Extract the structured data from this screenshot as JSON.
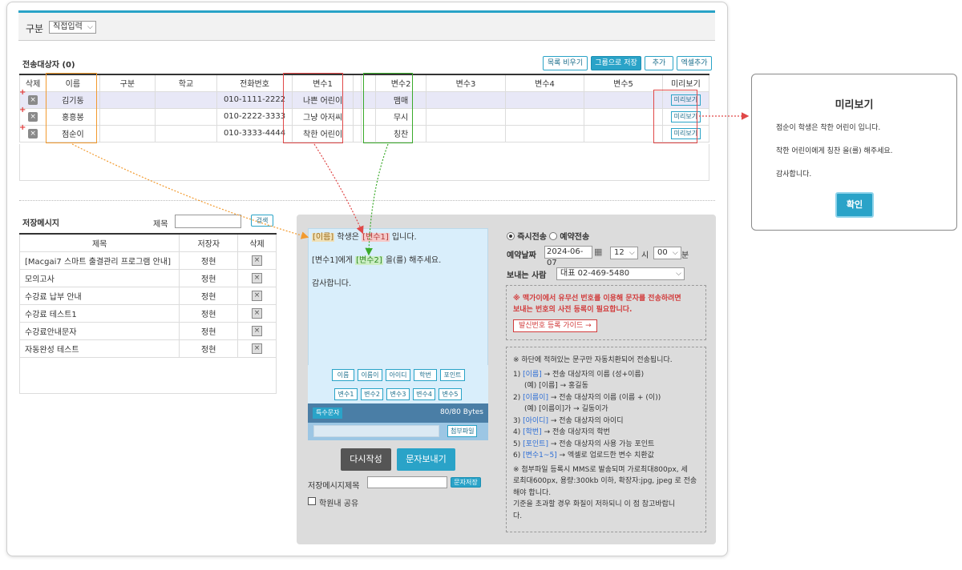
{
  "top": {
    "label": "구분",
    "select_value": "직접입력"
  },
  "recipients": {
    "title": "전송대상자 (0)",
    "buttons": [
      "목록 비우기",
      "그룹으로 저장",
      "추가",
      "엑셀추가"
    ],
    "columns": [
      "삭제",
      "이름",
      "구분",
      "학교",
      "전화번호",
      "변수1",
      "변수2",
      "변수3",
      "변수4",
      "변수5",
      "미리보기"
    ],
    "rows": [
      {
        "name": "김기동",
        "phone": "010-1111-2222",
        "v1": "나쁜 어린이",
        "v2": "맴매",
        "preview": "미리보기"
      },
      {
        "name": "홍흥봉",
        "phone": "010-2222-3333",
        "v1": "그냥 아저씨",
        "v2": "무시",
        "preview": "미리보기"
      },
      {
        "name": "점순이",
        "phone": "010-3333-4444",
        "v1": "착한 어린이",
        "v2": "칭찬",
        "preview": "미리보기"
      }
    ],
    "plus": "+",
    "delete_icon": "×"
  },
  "saved": {
    "title": "저장메시지",
    "search_label": "제목",
    "search_button": "검색",
    "columns": [
      "제목",
      "저장자",
      "삭제"
    ],
    "rows": [
      {
        "title": "[Macgai7 스마트 출결관리 프로그램 안내]",
        "author": "정현"
      },
      {
        "title": "모의고사",
        "author": "정현"
      },
      {
        "title": "수강료 납부 안내",
        "author": "정현"
      },
      {
        "title": "수강료 테스트1",
        "author": "정현"
      },
      {
        "title": "수강료안내문자",
        "author": "정현"
      },
      {
        "title": "자동완성 테스트",
        "author": "정현"
      }
    ]
  },
  "message": {
    "l1_name": "[이름]",
    "l1_mid": " 학생은 ",
    "l1_v1": "[변수1]",
    "l1_end": " 입니다.",
    "l2_start": "[변수1]에게 ",
    "l2_v2": "[변수2]",
    "l2_end": " 을(를) 해주세요.",
    "l3": "감사합니다.",
    "tokens_row1": [
      "이름",
      "이름이",
      "아이디",
      "학번",
      "포인트"
    ],
    "tokens_row2": [
      "변수1",
      "변수2",
      "변수3",
      "변수4",
      "변수5"
    ],
    "special_btn": "특수문자",
    "byte_count": "80/80 Bytes",
    "attach_btn": "첨부파일",
    "rewrite_btn": "다시작성",
    "send_btn": "문자보내기",
    "save_title_label": "저장메시지제목",
    "save_btn": "문자저장",
    "share_label": "학원내 공유"
  },
  "options": {
    "immediate": "즉시전송",
    "reserve": "예약전송",
    "date_label": "예약날짜",
    "date_value": "2024-06-07",
    "hour_value": "12",
    "hour_unit": "시",
    "minute_value": "00",
    "minute_unit": "분",
    "sender_label": "보내는 사람",
    "sender_value": "대표 02-469-5480",
    "warn_line1": "※ 맥가이에서 유무선 번호를 이용해 문자를 전송하려면",
    "warn_line2": "보내는 번호의 사전 등록이 필요합니다.",
    "warn_btn": "발신번호 등록 가이드 →",
    "guide_head": "※ 하단에 적혀있는 문구만 자동치환되어 전송됩니다.",
    "g1_pre": "1) ",
    "g1_k": "[이름]",
    "g1_t": " → 전송 대상자의 이름 (성+이름)",
    "g1_ex": "(예) [이름] → 홍길동",
    "g2_pre": "2) ",
    "g2_k": "[이름이]",
    "g2_t": " → 전송 대상자의 이름 (이름 + (이))",
    "g2_ex": "(예) [이름이]가 → 길동이가",
    "g3_pre": "3) ",
    "g3_k": "[아이디]",
    "g3_t": " → 전송 대상자의 아이디",
    "g4_pre": "4) ",
    "g4_k": "[학번]",
    "g4_t": " → 전송 대상자의 학번",
    "g5_pre": "5) ",
    "g5_k": "[포인트]",
    "g5_t": " → 전송 대상자의 사용 가능 포인트",
    "g6_pre": "6) ",
    "g6_k": "[변수1~5]",
    "g6_t": " → 엑셀로 업로드한 변수 치환값",
    "note1": "※ 첨부파일 등록시 MMS로 발송되며 가로최대800px, 세",
    "note2": "로최대600px, 용량:300kb 이하, 확장자:jpg, jpeg 로 전송",
    "note3": "해야 합니다.",
    "note4": "기준을 초과할 경우 화질이 저하되니 이 점 참고바랍니",
    "note5": "다."
  },
  "preview": {
    "title": "미리보기",
    "line1": "점순이 학생은 착한 어린이 입니다.",
    "line2": "착한 어린이에게 칭찬 을(를) 해주세요.",
    "line3": "감사합니다.",
    "ok": "확인"
  },
  "colors": {
    "accent": "#2aa3c8",
    "name_box": "#f29a2e",
    "v1_box": "#e04848",
    "v2_box": "#3aaa2a"
  }
}
